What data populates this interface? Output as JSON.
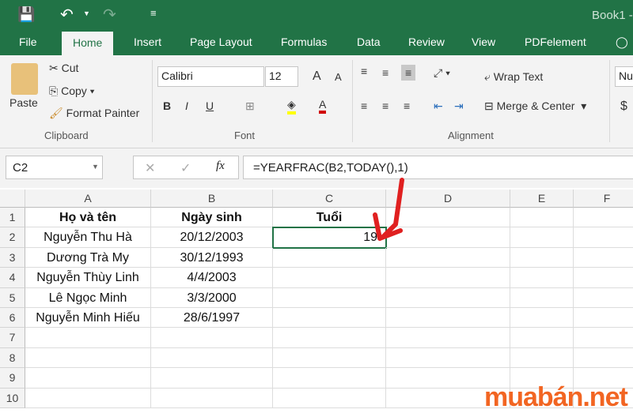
{
  "title_bar": {
    "title": "Book1 -"
  },
  "tabs": [
    "File",
    "Home",
    "Insert",
    "Page Layout",
    "Formulas",
    "Data",
    "Review",
    "View",
    "PDFelement"
  ],
  "active_tab": "Home",
  "ribbon": {
    "clipboard": {
      "paste": "Paste",
      "cut": "Cut",
      "copy": "Copy",
      "format_painter": "Format Painter",
      "label": "Clipboard"
    },
    "font": {
      "name": "Calibri",
      "size": "12",
      "bold": "B",
      "italic": "I",
      "underline": "U",
      "label": "Font",
      "grow": "A",
      "shrink": "A"
    },
    "alignment": {
      "wrap_text": "Wrap Text",
      "merge_center": "Merge & Center",
      "label": "Alignment"
    },
    "number": {
      "format": "Nu",
      "currency": "$"
    }
  },
  "formula_bar": {
    "name_box": "C2",
    "fx": "fx",
    "formula": "=YEARFRAC(B2,TODAY(),1)"
  },
  "columns": [
    "A",
    "B",
    "C",
    "D",
    "E",
    "F"
  ],
  "rows": [
    "1",
    "2",
    "3",
    "4",
    "5",
    "6",
    "7",
    "8",
    "9",
    "10"
  ],
  "cells": [
    [
      "Họ và tên",
      "Ngày sinh",
      "Tuổi"
    ],
    [
      "Nguyễn Thu Hà",
      "20/12/2003",
      "19"
    ],
    [
      "Dương Trà My",
      "30/12/1993",
      ""
    ],
    [
      "Nguyễn Thùy Linh",
      "4/4/2003",
      ""
    ],
    [
      "Lê Ngọc Minh",
      "3/3/2000",
      ""
    ],
    [
      "Nguyễn Minh Hiếu",
      "28/6/1997",
      ""
    ]
  ],
  "watermark": "muabán.net",
  "colors": {
    "excel_green": "#217346",
    "arrow": "#e02020",
    "watermark": "#f26522"
  }
}
